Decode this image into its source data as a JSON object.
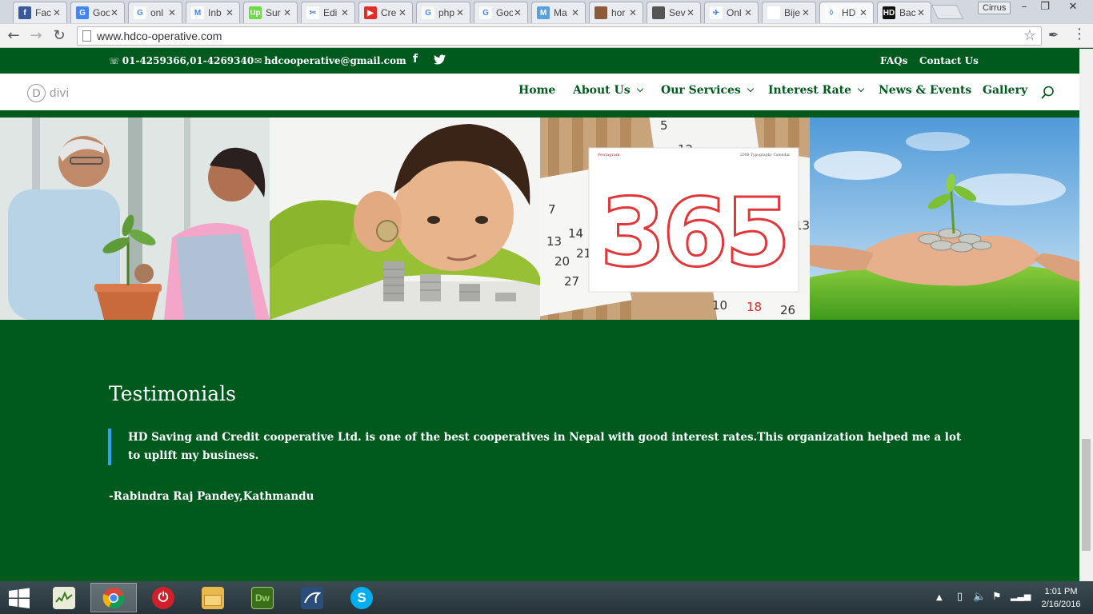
{
  "browser": {
    "tabs": [
      {
        "label": "Fac",
        "favicon": "facebook-icon",
        "color": "#3b5998",
        "glyph": "f"
      },
      {
        "label": "Goo",
        "favicon": "google-translate-icon",
        "color": "#4285f4",
        "glyph": "G"
      },
      {
        "label": "onl",
        "favicon": "google-icon",
        "color": "#ffffff",
        "glyph": "G"
      },
      {
        "label": "Inb",
        "favicon": "gmail-icon",
        "color": "#ffffff",
        "glyph": "M"
      },
      {
        "label": "Sur",
        "favicon": "upwork-icon",
        "color": "#6fda44",
        "glyph": "Up"
      },
      {
        "label": "Edi",
        "favicon": "tools-icon",
        "color": "#ffffff",
        "glyph": "✂"
      },
      {
        "label": "Cre",
        "favicon": "youtube-icon",
        "color": "#e52d27",
        "glyph": "▶"
      },
      {
        "label": "php",
        "favicon": "google-icon",
        "color": "#ffffff",
        "glyph": "G"
      },
      {
        "label": "Goo",
        "favicon": "google-icon",
        "color": "#ffffff",
        "glyph": "G"
      },
      {
        "label": "Ma",
        "favicon": "maps-icon",
        "color": "#5aa0dc",
        "glyph": "M"
      },
      {
        "label": "hor",
        "favicon": "photo-icon",
        "color": "#8a5a3a",
        "glyph": ""
      },
      {
        "label": "Sev",
        "favicon": "photo-icon",
        "color": "#555555",
        "glyph": ""
      },
      {
        "label": "Onl",
        "favicon": "bird-icon",
        "color": "#ffffff",
        "glyph": "✈"
      },
      {
        "label": "Bije",
        "favicon": "document-icon",
        "color": "#ffffff",
        "glyph": ""
      },
      {
        "label": "HD",
        "favicon": "divi-icon",
        "color": "#ffffff",
        "glyph": "◊"
      },
      {
        "label": "Bac",
        "favicon": "hd-icon",
        "color": "#111111",
        "glyph": "HD"
      }
    ],
    "active_tab": 14,
    "user": "Cirrus",
    "url": "www.hdco-operative.com"
  },
  "site": {
    "topbar": {
      "phone": "01-4259366,01-4269340",
      "email": "hdcooperative@gmail.com",
      "links": [
        "FAQs",
        "Contact Us"
      ]
    },
    "logo_text": "divi",
    "nav": [
      {
        "label": "Home",
        "dropdown": false
      },
      {
        "label": "About Us",
        "dropdown": true
      },
      {
        "label": "Our Services",
        "dropdown": true
      },
      {
        "label": "Interest Rate",
        "dropdown": true
      },
      {
        "label": "News & Events",
        "dropdown": true
      },
      {
        "label": "Gallery",
        "dropdown": false
      }
    ],
    "calendar": {
      "big_number": "365",
      "brand": "Pentagram",
      "caption": "2008 Typography Calendar"
    },
    "testimonials": {
      "title": "Testimonials",
      "quote": "HD Saving and Credit cooperative Ltd. is one of the best cooperatives in Nepal with good interest rates.This organization helped me a lot to uplift my business.",
      "author": "-Rabindra Raj Pandey,Kathmandu"
    },
    "colors": {
      "brand_green": "#005a1e",
      "quote_border": "#2ea3f2"
    }
  },
  "taskbar": {
    "apps": [
      {
        "name": "task-manager-icon",
        "glyph": "",
        "color": "#5c7d2e"
      },
      {
        "name": "chrome-icon",
        "glyph": "",
        "color": "#ffffff"
      },
      {
        "name": "power-icon",
        "glyph": "⏻",
        "color": "#d0202a"
      },
      {
        "name": "file-explorer-icon",
        "glyph": "",
        "color": "#e8b84a"
      },
      {
        "name": "dreamweaver-icon",
        "glyph": "Dw",
        "color": "#3a6e1a"
      },
      {
        "name": "mysql-workbench-icon",
        "glyph": "",
        "color": "#2a4d7a"
      },
      {
        "name": "skype-icon",
        "glyph": "S",
        "color": "#00aff0"
      }
    ],
    "time": "1:01 PM",
    "date": "2/16/2016"
  }
}
